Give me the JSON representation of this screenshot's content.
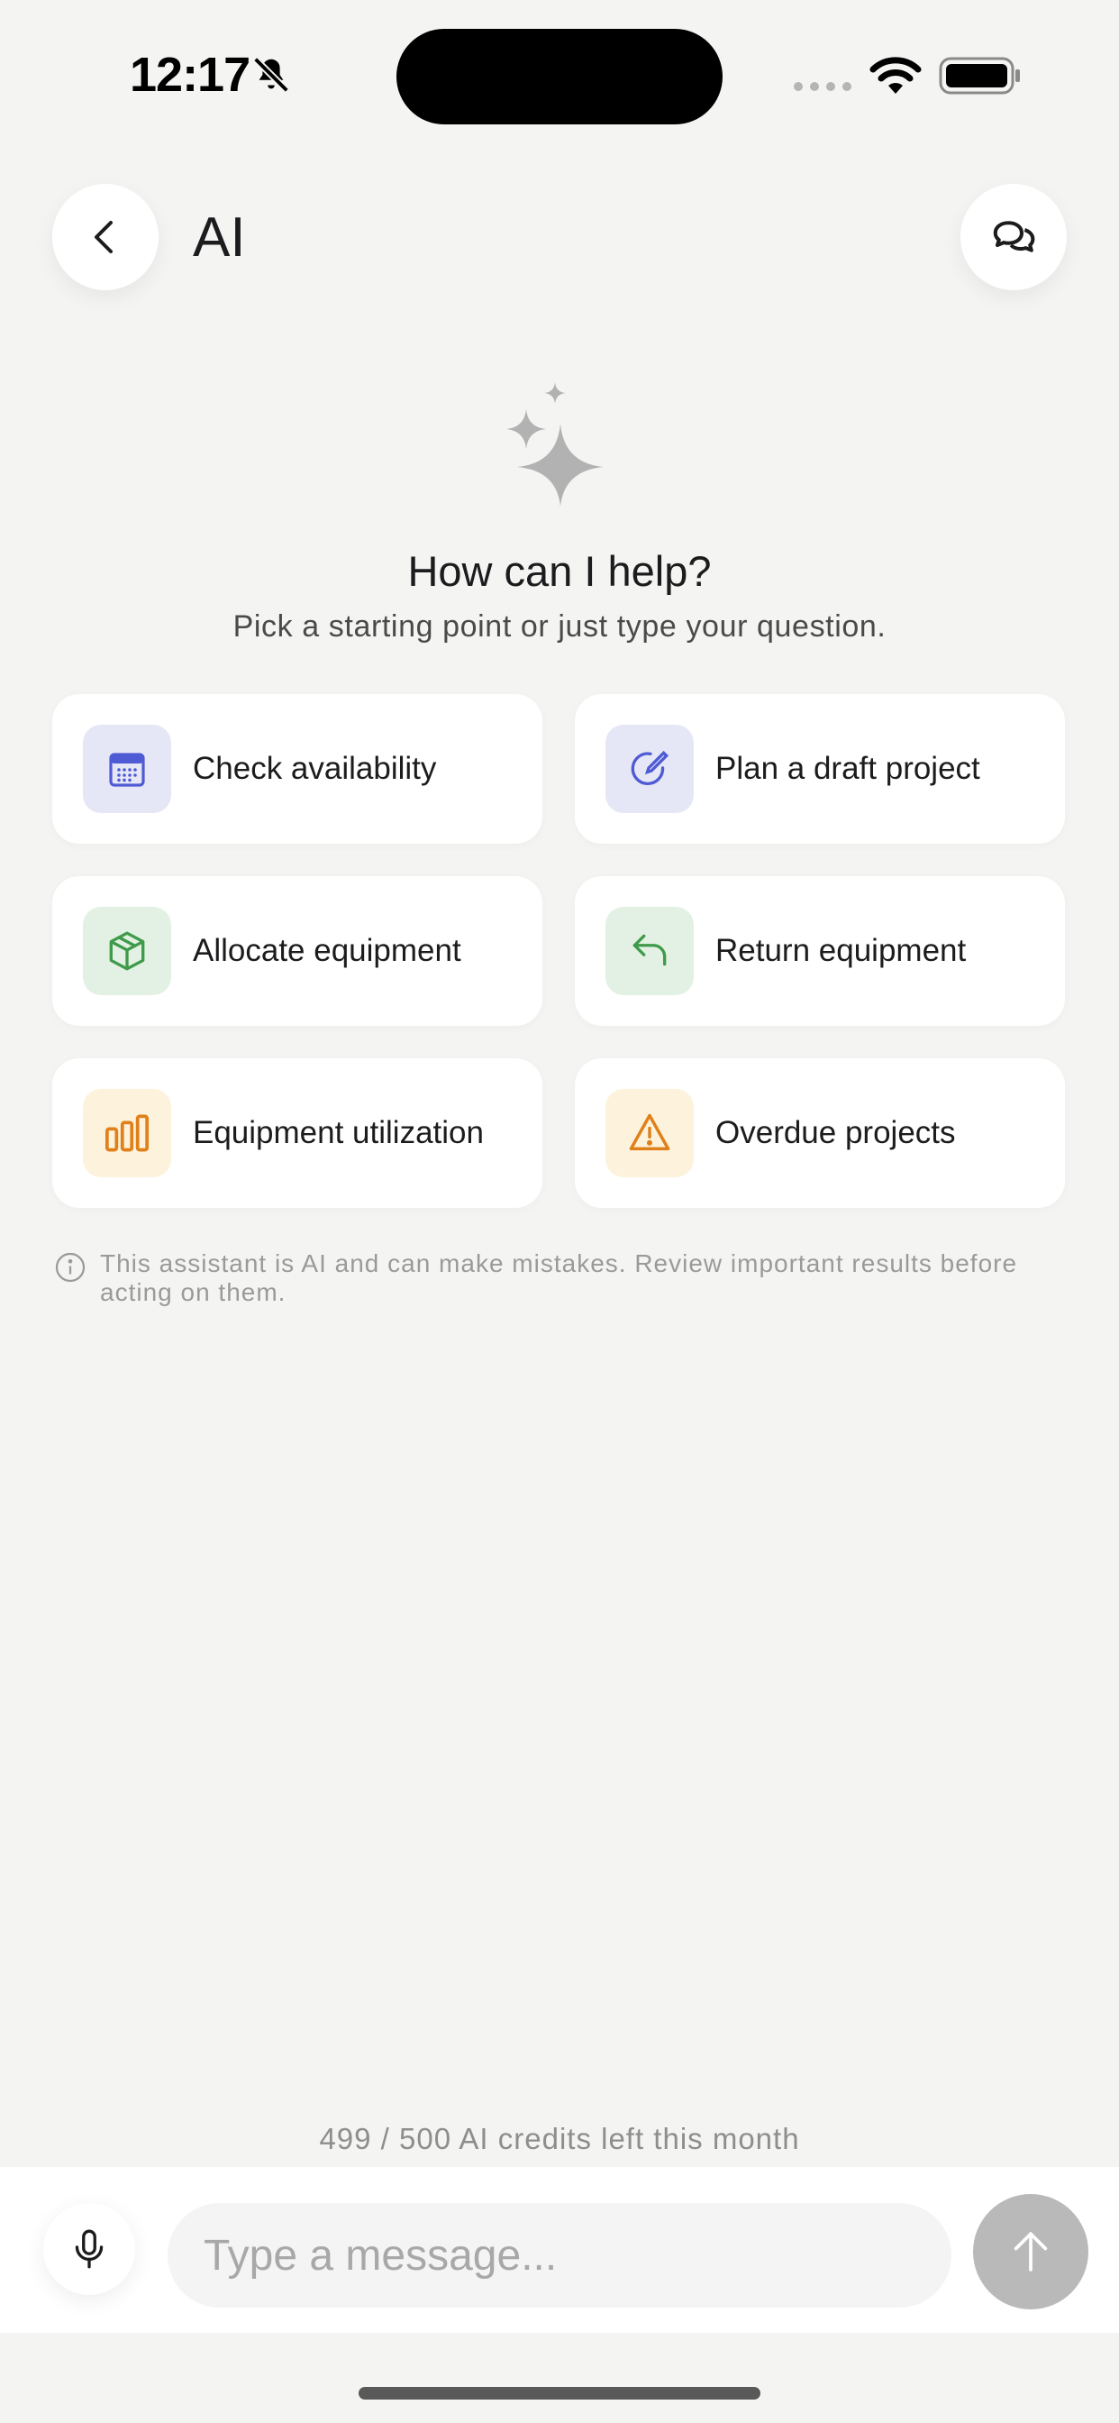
{
  "status_bar": {
    "time": "12:17",
    "icons": [
      "bell-slash-icon",
      "cellular-signal-icon",
      "wifi-icon",
      "battery-icon"
    ]
  },
  "header": {
    "title": "AI",
    "back_icon": "chevron-left-icon",
    "chat_icon": "chat-bubbles-icon"
  },
  "hero": {
    "icon": "sparkles-icon",
    "title": "How can I help?",
    "subtitle": "Pick a starting point or just type your question."
  },
  "suggestions": [
    {
      "label": "Check availability",
      "icon": "calendar-icon",
      "color": "#4f5bd5",
      "bg": "#e6e7f6"
    },
    {
      "label": "Plan a draft project",
      "icon": "compass-pencil-icon",
      "color": "#4f5bd5",
      "bg": "#e6e7f6"
    },
    {
      "label": "Allocate equipment",
      "icon": "box-icon",
      "color": "#3f9a4a",
      "bg": "#e3f1e4"
    },
    {
      "label": "Return equipment",
      "icon": "return-arrow-icon",
      "color": "#3f9a4a",
      "bg": "#e3f1e4"
    },
    {
      "label": "Equipment utilization",
      "icon": "bar-chart-icon",
      "color": "#e0801a",
      "bg": "#fdf3dc"
    },
    {
      "label": "Overdue projects",
      "icon": "warning-triangle-icon",
      "color": "#e0801a",
      "bg": "#fdf3dc"
    }
  ],
  "disclaimer": {
    "icon": "info-icon",
    "text": "This assistant is AI and can make mistakes. Review important results before acting on them."
  },
  "footer": {
    "credits": "499 / 500 AI credits left this month",
    "input_placeholder": "Type a message...",
    "mic_icon": "microphone-icon",
    "send_icon": "arrow-up-icon"
  }
}
